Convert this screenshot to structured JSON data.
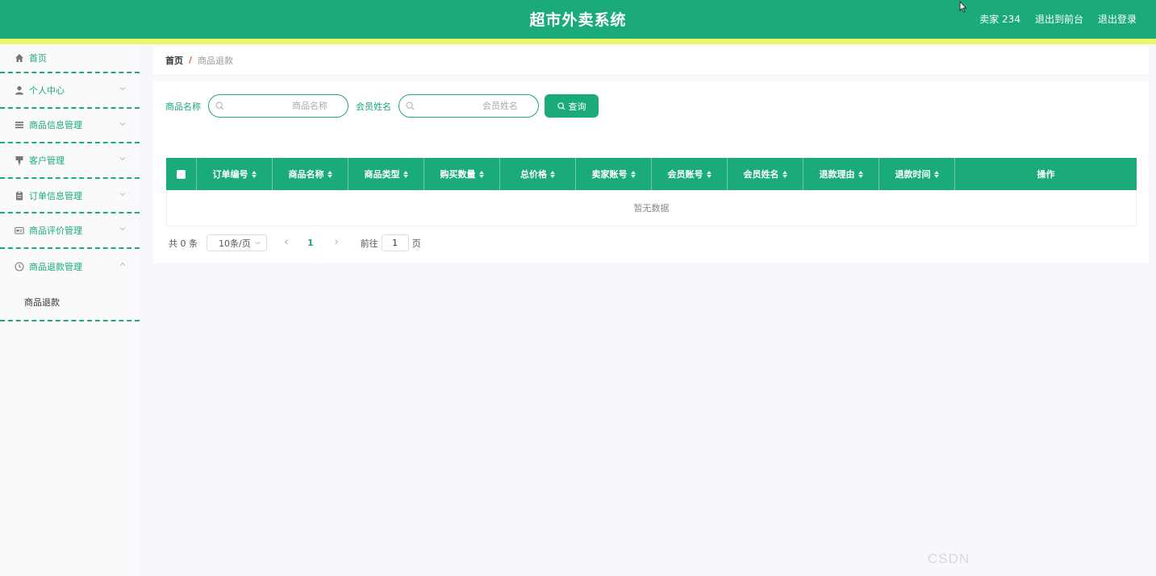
{
  "header": {
    "title": "超市外卖系统",
    "user": "卖家 234",
    "to_front": "退出到前台",
    "logout": "退出登录"
  },
  "sidebar": {
    "items": [
      {
        "label": "首页",
        "icon": "home-icon"
      },
      {
        "label": "个人中心",
        "icon": "user-icon"
      },
      {
        "label": "商品信息管理",
        "icon": "list-icon"
      },
      {
        "label": "客户管理",
        "icon": "stamp-icon"
      },
      {
        "label": "订单信息管理",
        "icon": "clipboard-icon"
      },
      {
        "label": "商品评价管理",
        "icon": "id-card-icon"
      },
      {
        "label": "商品退款管理",
        "icon": "clock-icon"
      }
    ],
    "sub_item": "商品退款"
  },
  "breadcrumb": {
    "home": "首页",
    "separator": "/",
    "current": "商品退款"
  },
  "search": {
    "field1_label": "商品名称",
    "field1_placeholder": "商品名称",
    "field2_label": "会员姓名",
    "field2_placeholder": "会员姓名",
    "query_label": "查询"
  },
  "table": {
    "columns": [
      "订单编号",
      "商品名称",
      "商品类型",
      "购买数量",
      "总价格",
      "卖家账号",
      "会员账号",
      "会员姓名",
      "退款理由",
      "退款时间"
    ],
    "action_column": "操作",
    "empty_text": "暂无数据"
  },
  "pager": {
    "total": "共 0 条",
    "page_size": "10条/页",
    "current_page": "1",
    "goto_label": "前往",
    "goto_value": "1",
    "page_unit": "页"
  },
  "watermark": "CSDN",
  "colors": {
    "primary": "#1aaa7c",
    "stripe": "#e9f96b",
    "separator": "#e4572e"
  }
}
